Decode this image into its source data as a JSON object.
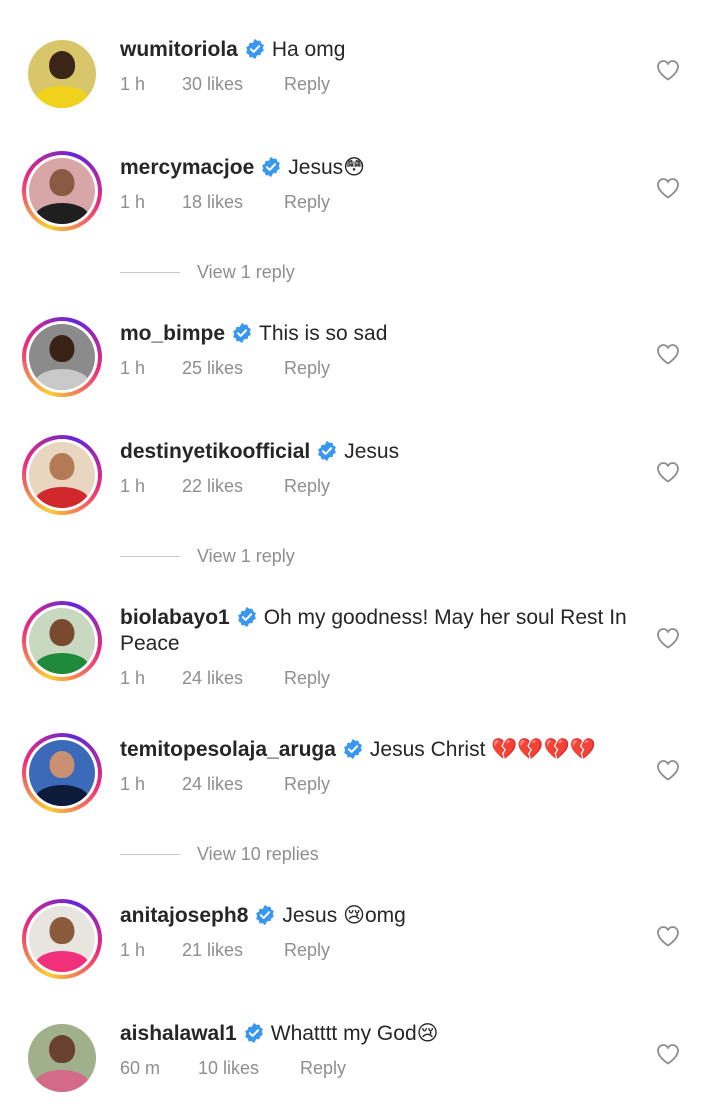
{
  "comments": [
    {
      "username": "wumitoriola",
      "text": "Ha omg",
      "time": "1 h",
      "likes": "30 likes",
      "reply": "Reply",
      "ring": false,
      "skin": "#3b2418",
      "cloth": "#f0d21c",
      "bg": "#d9c66a"
    },
    {
      "username": "mercymacjoe",
      "text": "Jesus😳",
      "time": "1 h",
      "likes": "18 likes",
      "reply": "Reply",
      "ring": true,
      "skin": "#8a5a44",
      "cloth": "#1f1f1f",
      "bg": "#d9a6a8"
    },
    {
      "username": "mo_bimpe",
      "text": "This is so sad",
      "time": "1 h",
      "likes": "25 likes",
      "reply": "Reply",
      "ring": true,
      "skin": "#3a2116",
      "cloth": "#c9c9c9",
      "bg": "#8b8b8b"
    },
    {
      "username": "destinyetikoofficial",
      "text": "Jesus",
      "time": "1 h",
      "likes": "22 likes",
      "reply": "Reply",
      "ring": true,
      "skin": "#b47a56",
      "cloth": "#d0282c",
      "bg": "#e8d6c0"
    },
    {
      "username": "biolabayo1",
      "text": "Oh my goodness! May her soul Rest In Peace",
      "time": "1 h",
      "likes": "24 likes",
      "reply": "Reply",
      "ring": true,
      "skin": "#7a4a30",
      "cloth": "#1f8a3c",
      "bg": "#c9d8c0"
    },
    {
      "username": "temitopesolaja_aruga",
      "text": "Jesus Christ 💔💔💔💔",
      "time": "1 h",
      "likes": "24 likes",
      "reply": "Reply",
      "ring": true,
      "skin": "#c99072",
      "cloth": "#0e1a3a",
      "bg": "#3a6ab8"
    },
    {
      "username": "anitajoseph8",
      "text": "Jesus 😢omg",
      "time": "1 h",
      "likes": "21 likes",
      "reply": "Reply",
      "ring": true,
      "skin": "#8a5a3c",
      "cloth": "#f0307a",
      "bg": "#e8e4e0"
    },
    {
      "username": "aishalawal1",
      "text": "Whatttt my God😢",
      "time": "60 m",
      "likes": "10 likes",
      "reply": "Reply",
      "ring": false,
      "skin": "#6a4030",
      "cloth": "#d36a8a",
      "bg": "#9fb08a"
    }
  ],
  "view_replies": [
    "View 1 reply",
    "View 1 reply",
    "View 10 replies"
  ],
  "colors": {
    "verified": "#3897f0",
    "meta": "#8e8e8e",
    "text": "#262626"
  }
}
